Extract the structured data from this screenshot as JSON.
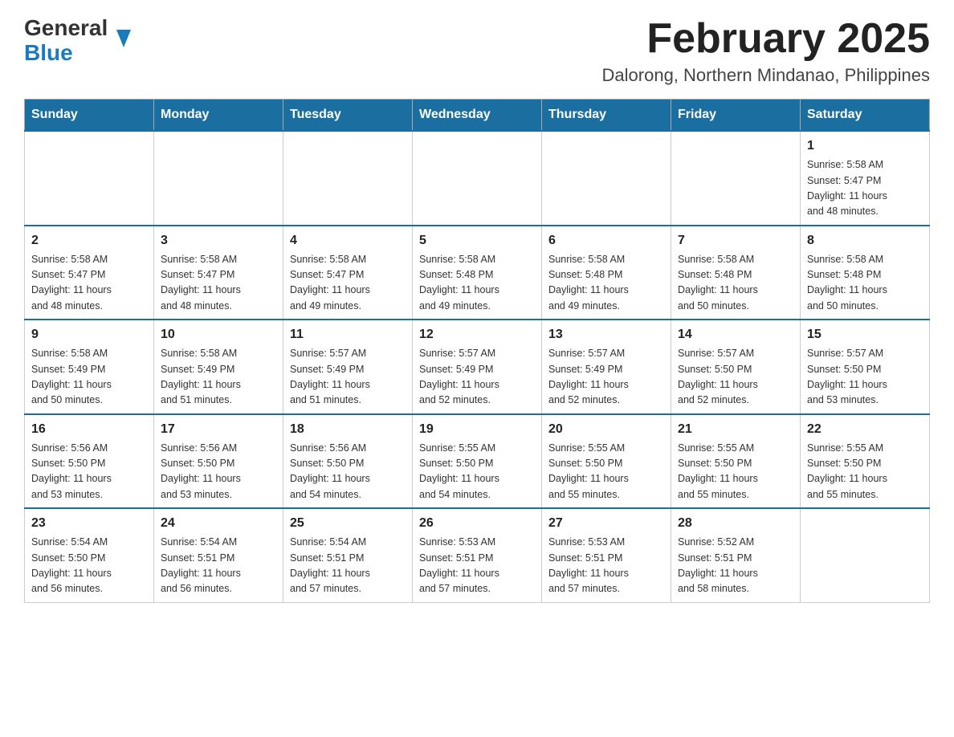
{
  "header": {
    "logo_general": "General",
    "logo_blue": "Blue",
    "month_year": "February 2025",
    "location": "Dalorong, Northern Mindanao, Philippines"
  },
  "weekdays": [
    "Sunday",
    "Monday",
    "Tuesday",
    "Wednesday",
    "Thursday",
    "Friday",
    "Saturday"
  ],
  "weeks": [
    [
      {
        "day": "",
        "info": ""
      },
      {
        "day": "",
        "info": ""
      },
      {
        "day": "",
        "info": ""
      },
      {
        "day": "",
        "info": ""
      },
      {
        "day": "",
        "info": ""
      },
      {
        "day": "",
        "info": ""
      },
      {
        "day": "1",
        "info": "Sunrise: 5:58 AM\nSunset: 5:47 PM\nDaylight: 11 hours\nand 48 minutes."
      }
    ],
    [
      {
        "day": "2",
        "info": "Sunrise: 5:58 AM\nSunset: 5:47 PM\nDaylight: 11 hours\nand 48 minutes."
      },
      {
        "day": "3",
        "info": "Sunrise: 5:58 AM\nSunset: 5:47 PM\nDaylight: 11 hours\nand 48 minutes."
      },
      {
        "day": "4",
        "info": "Sunrise: 5:58 AM\nSunset: 5:47 PM\nDaylight: 11 hours\nand 49 minutes."
      },
      {
        "day": "5",
        "info": "Sunrise: 5:58 AM\nSunset: 5:48 PM\nDaylight: 11 hours\nand 49 minutes."
      },
      {
        "day": "6",
        "info": "Sunrise: 5:58 AM\nSunset: 5:48 PM\nDaylight: 11 hours\nand 49 minutes."
      },
      {
        "day": "7",
        "info": "Sunrise: 5:58 AM\nSunset: 5:48 PM\nDaylight: 11 hours\nand 50 minutes."
      },
      {
        "day": "8",
        "info": "Sunrise: 5:58 AM\nSunset: 5:48 PM\nDaylight: 11 hours\nand 50 minutes."
      }
    ],
    [
      {
        "day": "9",
        "info": "Sunrise: 5:58 AM\nSunset: 5:49 PM\nDaylight: 11 hours\nand 50 minutes."
      },
      {
        "day": "10",
        "info": "Sunrise: 5:58 AM\nSunset: 5:49 PM\nDaylight: 11 hours\nand 51 minutes."
      },
      {
        "day": "11",
        "info": "Sunrise: 5:57 AM\nSunset: 5:49 PM\nDaylight: 11 hours\nand 51 minutes."
      },
      {
        "day": "12",
        "info": "Sunrise: 5:57 AM\nSunset: 5:49 PM\nDaylight: 11 hours\nand 52 minutes."
      },
      {
        "day": "13",
        "info": "Sunrise: 5:57 AM\nSunset: 5:49 PM\nDaylight: 11 hours\nand 52 minutes."
      },
      {
        "day": "14",
        "info": "Sunrise: 5:57 AM\nSunset: 5:50 PM\nDaylight: 11 hours\nand 52 minutes."
      },
      {
        "day": "15",
        "info": "Sunrise: 5:57 AM\nSunset: 5:50 PM\nDaylight: 11 hours\nand 53 minutes."
      }
    ],
    [
      {
        "day": "16",
        "info": "Sunrise: 5:56 AM\nSunset: 5:50 PM\nDaylight: 11 hours\nand 53 minutes."
      },
      {
        "day": "17",
        "info": "Sunrise: 5:56 AM\nSunset: 5:50 PM\nDaylight: 11 hours\nand 53 minutes."
      },
      {
        "day": "18",
        "info": "Sunrise: 5:56 AM\nSunset: 5:50 PM\nDaylight: 11 hours\nand 54 minutes."
      },
      {
        "day": "19",
        "info": "Sunrise: 5:55 AM\nSunset: 5:50 PM\nDaylight: 11 hours\nand 54 minutes."
      },
      {
        "day": "20",
        "info": "Sunrise: 5:55 AM\nSunset: 5:50 PM\nDaylight: 11 hours\nand 55 minutes."
      },
      {
        "day": "21",
        "info": "Sunrise: 5:55 AM\nSunset: 5:50 PM\nDaylight: 11 hours\nand 55 minutes."
      },
      {
        "day": "22",
        "info": "Sunrise: 5:55 AM\nSunset: 5:50 PM\nDaylight: 11 hours\nand 55 minutes."
      }
    ],
    [
      {
        "day": "23",
        "info": "Sunrise: 5:54 AM\nSunset: 5:50 PM\nDaylight: 11 hours\nand 56 minutes."
      },
      {
        "day": "24",
        "info": "Sunrise: 5:54 AM\nSunset: 5:51 PM\nDaylight: 11 hours\nand 56 minutes."
      },
      {
        "day": "25",
        "info": "Sunrise: 5:54 AM\nSunset: 5:51 PM\nDaylight: 11 hours\nand 57 minutes."
      },
      {
        "day": "26",
        "info": "Sunrise: 5:53 AM\nSunset: 5:51 PM\nDaylight: 11 hours\nand 57 minutes."
      },
      {
        "day": "27",
        "info": "Sunrise: 5:53 AM\nSunset: 5:51 PM\nDaylight: 11 hours\nand 57 minutes."
      },
      {
        "day": "28",
        "info": "Sunrise: 5:52 AM\nSunset: 5:51 PM\nDaylight: 11 hours\nand 58 minutes."
      },
      {
        "day": "",
        "info": ""
      }
    ]
  ]
}
